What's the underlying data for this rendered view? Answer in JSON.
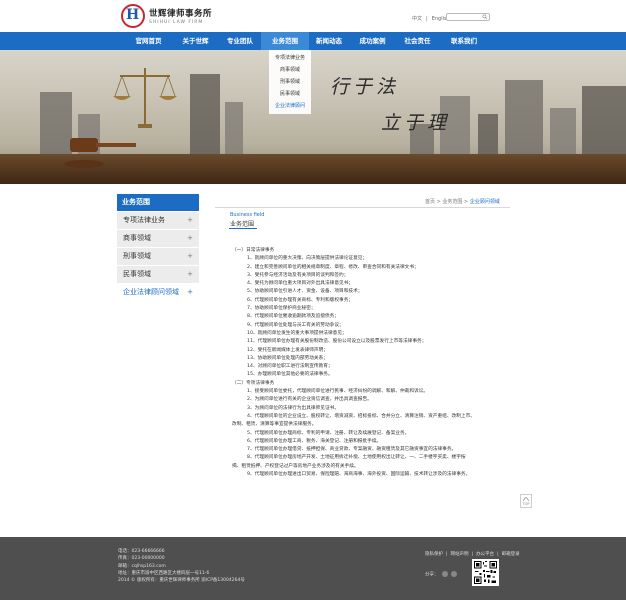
{
  "header": {
    "logo_cn": "世辉律师事务所",
    "logo_en": "SHIHUI LAW FIRM",
    "lang_cn": "中文",
    "lang_sep": "|",
    "lang_en": "English",
    "search_placeholder": ""
  },
  "nav": {
    "items": [
      "官网首页",
      "关于世辉",
      "专业团队",
      "业务范围",
      "新闻动态",
      "成功案例",
      "社会责任",
      "联系我们"
    ],
    "active_index": 3
  },
  "dropdown": {
    "items": [
      "专项法律业务",
      "商事领域",
      "刑事领域",
      "民事领域",
      "企业法律顾问"
    ],
    "active_index": 4
  },
  "banner": {
    "line1": "行于法",
    "line2": "立于理"
  },
  "sidebar": {
    "title": "业务范围",
    "items": [
      {
        "label": "专项法律业务",
        "plus": "+"
      },
      {
        "label": "商事领域",
        "plus": "+"
      },
      {
        "label": "刑事领域",
        "plus": "+"
      },
      {
        "label": "民事领域",
        "plus": "+"
      },
      {
        "label": "企业法律顾问领域",
        "plus": "+"
      }
    ],
    "active_index": 4
  },
  "breadcrumb": {
    "home": "首页",
    "sep1": ">",
    "section": "业务范围",
    "sep2": ">",
    "current": "企业顾问领域"
  },
  "section": {
    "en": "Business field",
    "cn": "业务范围"
  },
  "content": {
    "lines": [
      {
        "t": "（一）日常法律事务",
        "cls": ""
      },
      {
        "t": "1、就顾问单位的重大决策、向决策层提供法律论证意见；",
        "cls": "ind"
      },
      {
        "t": "2、建立和完善顾问单位的相关规章制度、章程、修改、审查合同和有关法律文书；",
        "cls": "ind"
      },
      {
        "t": "3、受托参与经济活动及有关项目的谈判和签约；",
        "cls": "ind"
      },
      {
        "t": "4、受托为顾问单位重大项目对外出具法律意见书；",
        "cls": "ind"
      },
      {
        "t": "5、协助顾问单位引进人才、资金、设备、项目和技术；",
        "cls": "ind"
      },
      {
        "t": "6、代理顾问单位办理有关商标、专利和版权事务；",
        "cls": "ind"
      },
      {
        "t": "7、协助顾问单位保护商业秘密；",
        "cls": "ind"
      },
      {
        "t": "8、代理顾问单位催收逾期款项及追偿债务；",
        "cls": "ind"
      },
      {
        "t": "9、代理顾问单位处理与员工有关的劳动争议；",
        "cls": "ind"
      },
      {
        "t": "10、就顾问单位发生的重大事项提供法律意见；",
        "cls": "ind"
      },
      {
        "t": "11、代理顾问单位办理有关股份制改造、股份公司设立以及股票发行上市等法律事务；",
        "cls": "ind"
      },
      {
        "t": "12、受托在新闻媒体上发表律师声明；",
        "cls": "ind"
      },
      {
        "t": "13、协助顾问单位处理内部劳动关系；",
        "cls": "ind"
      },
      {
        "t": "14、对顾问单位职工进行法制宣传教育；",
        "cls": "ind"
      },
      {
        "t": "15、办理顾问单位其他必要的法律事务。",
        "cls": "ind"
      },
      {
        "t": "（二）专项法律事务",
        "cls": ""
      },
      {
        "t": "1、接受顾问单位委托，代理顾问单位进行民事、经济纠纷的调解、和解、仲裁和诉讼。",
        "cls": "ind"
      },
      {
        "t": "2、为顾问单位进行有关的企业资信调查，并出具调查报告。",
        "cls": "ind"
      },
      {
        "t": "3、为顾问单位的法律行为出具律师见证书。",
        "cls": "ind"
      },
      {
        "t": "4、代理顾问单位的企业设立、股权转让、增资减资、招标投标、合并分立、清算注销、资产重组、改制上市、",
        "cls": "ind"
      },
      {
        "t": "改制、租赁、清算等事宜提供法律服务。",
        "cls": ""
      },
      {
        "t": "5、代理顾问单位办理商标、专利的申请、注册、转让及续展登记、备案业务。",
        "cls": "ind"
      },
      {
        "t": "6、代理顾问单位办理工商、税务、海关登记、注册和报批手续。",
        "cls": "ind"
      },
      {
        "t": "7、代理顾问单位办理借贷、抵押担保、商业贷款、专案融资、融资租赁及其它融资事宜的法律事务。",
        "cls": "ind"
      },
      {
        "t": "8、代理顾问单位办理房地产开发、土地征用拆迁补偿、土地使用权出让转让、一、二手楼宇买卖、楼宇按",
        "cls": "ind"
      },
      {
        "t": "揭、租赁抵押、产权登记过户等房地产业务涉及的有关手续。",
        "cls": ""
      },
      {
        "t": "9、代理顾问单位办理进出口贸易、保险理赔、海商海事、海外投资、国际运输、技术转让涉及的法律事务。",
        "cls": "ind"
      }
    ]
  },
  "top_button": "TOP",
  "footer": {
    "info": [
      "电话：023-66666666",
      "传真：023-00000000",
      "邮箱：cqlhsp163.com",
      "地址：重庆市渝中区西路区大楼四层一号11-6",
      "2014 © 版权所有：重庆世辉律师事务所   渝ICP备13004264号"
    ],
    "links": [
      "隐私保护",
      "网站声明",
      "办公平台",
      "邮箱登录"
    ],
    "link_seps": [
      "|",
      "|",
      "|"
    ],
    "share_label": "分享："
  }
}
